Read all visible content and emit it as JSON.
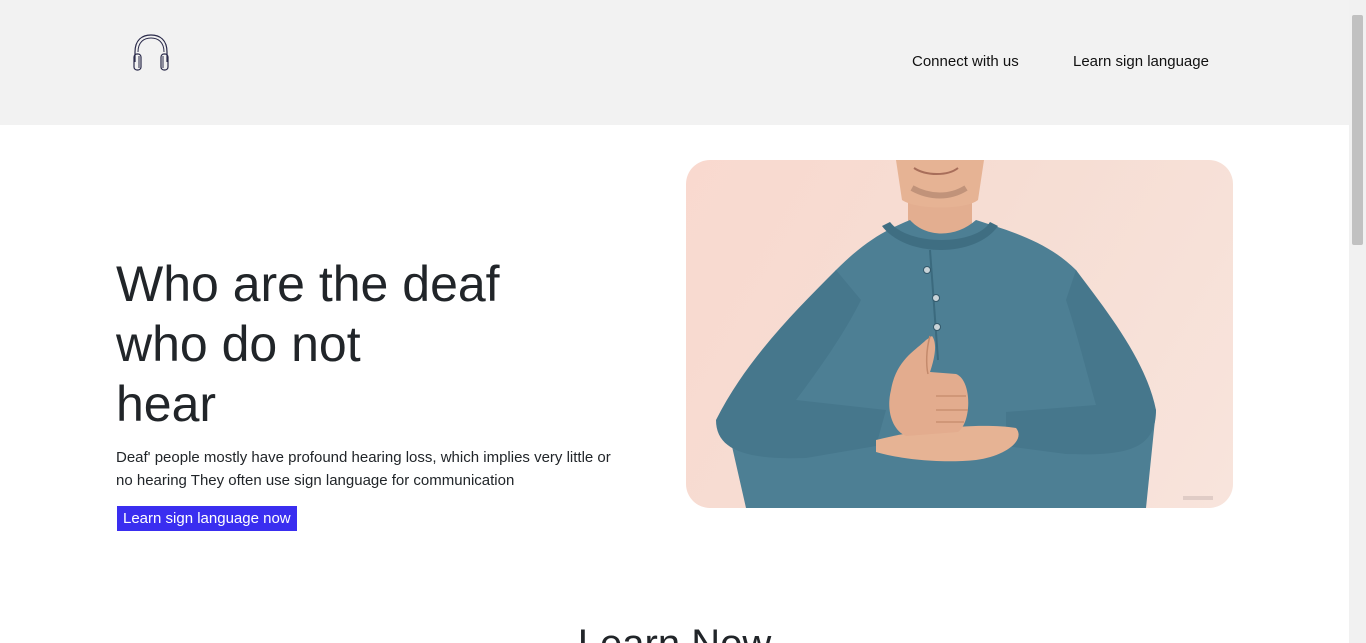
{
  "nav": {
    "logo_icon": "headphones-icon",
    "links": [
      {
        "label": "Connect with us"
      },
      {
        "label": "Learn sign language"
      }
    ]
  },
  "hero": {
    "title": "Who are the deaf\nwho do not\nhear",
    "text": "Deaf' people mostly have profound hearing loss, which implies very little or no hearing They often use sign language for communication",
    "button_label": "Learn sign language now",
    "image_icon": "person-signing-image",
    "colors": {
      "button": "#3a2ef0",
      "shirt": "#4d7f94",
      "skin": "#e6b394"
    }
  },
  "section": {
    "title": "Learn Now"
  }
}
